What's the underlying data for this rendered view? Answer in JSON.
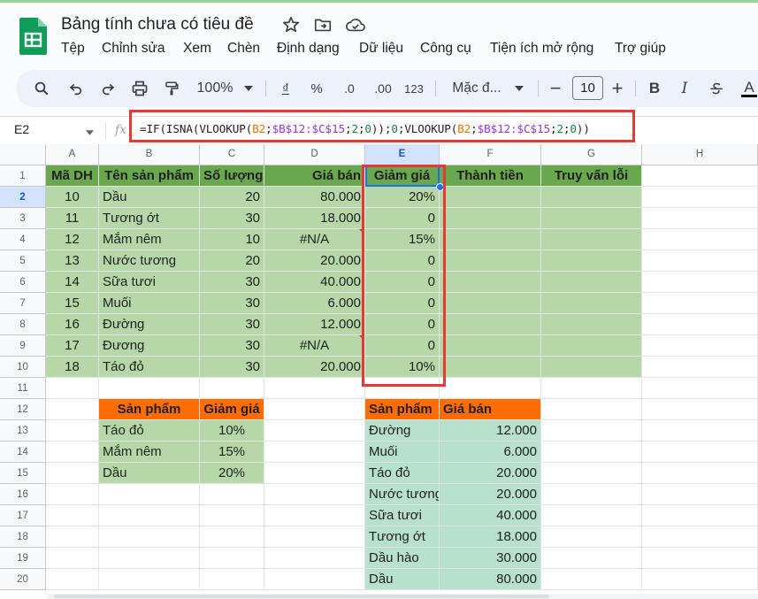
{
  "app": {
    "doc_title": "Bảng tính chưa có tiêu đề",
    "title_icons": [
      "star-icon",
      "move-folder-icon",
      "cloud-status-icon"
    ],
    "menu": [
      "Tệp",
      "Chỉnh sửa",
      "Xem",
      "Chèn",
      "Định dạng",
      "Dữ liệu",
      "Công cụ",
      "Tiện ích mở rộng",
      "Trợ giúp"
    ]
  },
  "toolbar": {
    "icons": [
      "search-icon",
      "undo-icon",
      "redo-icon",
      "print-icon",
      "paint-format-icon"
    ],
    "zoom": "100%",
    "currency": "₫",
    "percent": "%",
    "decrease_decimal": ".0",
    "increase_decimal": ".00",
    "number_format": "123",
    "font_name": "Mặc đ...",
    "font_size": "10",
    "minus": "−",
    "plus": "+",
    "bold": "B",
    "italic": "I",
    "text_color": "A"
  },
  "formula_bar": {
    "cell_ref": "E2",
    "fx": "fx",
    "formula_parts": [
      "=IF(ISNA(VLOOKUP(",
      "B2",
      ";",
      "$B$12:$C$15",
      ";",
      "2",
      ";",
      "0",
      "));",
      "0",
      ";VLOOKUP(",
      "B2",
      ";",
      "$B$12:$C$15",
      ";",
      "2",
      ";",
      "0",
      "))"
    ]
  },
  "colors": {
    "green_header": "#6aa84f",
    "green_body": "#b6d7a8",
    "orange_header": "#ff6d01",
    "teal_body": "#b7e1cd",
    "highlight_red": "#e53935",
    "selection_blue": "#1a73e8"
  },
  "grid": {
    "columns": [
      "A",
      "B",
      "C",
      "D",
      "E",
      "F",
      "G",
      "H"
    ],
    "rows": [
      "1",
      "2",
      "3",
      "4",
      "5",
      "6",
      "7",
      "8",
      "9",
      "10",
      "11",
      "12",
      "13",
      "14",
      "15",
      "16",
      "17",
      "18",
      "19",
      "20"
    ],
    "selected_column": "E",
    "selected_row": "2",
    "main_headers": [
      "Mã DH",
      "Tên sản phẩm",
      "Số lượng",
      "Giá bán",
      "Giảm giá",
      "Thành tiền",
      "Truy vấn lỗi"
    ],
    "main_rows": [
      [
        "10",
        "Dầu",
        "20",
        "80.000",
        "20%",
        "",
        ""
      ],
      [
        "11",
        "Tương ớt",
        "30",
        "18.000",
        "0",
        "",
        ""
      ],
      [
        "12",
        "Mắm nêm",
        "10",
        "#N/A",
        "15%",
        "",
        ""
      ],
      [
        "13",
        "Nước tương",
        "20",
        "20.000",
        "0",
        "",
        ""
      ],
      [
        "14",
        "Sữa tươi",
        "30",
        "40.000",
        "0",
        "",
        ""
      ],
      [
        "15",
        "Muối",
        "30",
        "6.000",
        "0",
        "",
        ""
      ],
      [
        "16",
        "Đường",
        "30",
        "12.000",
        "0",
        "",
        ""
      ],
      [
        "17",
        "Đương",
        "30",
        "#N/A",
        "0",
        "",
        ""
      ],
      [
        "18",
        "Táo đỏ",
        "30",
        "20.000",
        "10%",
        "",
        ""
      ]
    ],
    "discount_table": {
      "headers": [
        "Sản phẩm",
        "Giảm giá"
      ],
      "rows": [
        [
          "Táo đỏ",
          "10%"
        ],
        [
          "Mắm nêm",
          "15%"
        ],
        [
          "Dầu",
          "20%"
        ]
      ]
    },
    "price_table": {
      "headers": [
        "Sản phẩm",
        "Giá bán"
      ],
      "rows": [
        [
          "Đường",
          "12.000"
        ],
        [
          "Muối",
          "6.000"
        ],
        [
          "Táo đỏ",
          "20.000"
        ],
        [
          "Nước tương",
          "20.000"
        ],
        [
          "Sữa tươi",
          "40.000"
        ],
        [
          "Tương ớt",
          "18.000"
        ],
        [
          "Dầu hào",
          "30.000"
        ],
        [
          "Dầu",
          "80.000"
        ]
      ]
    }
  }
}
